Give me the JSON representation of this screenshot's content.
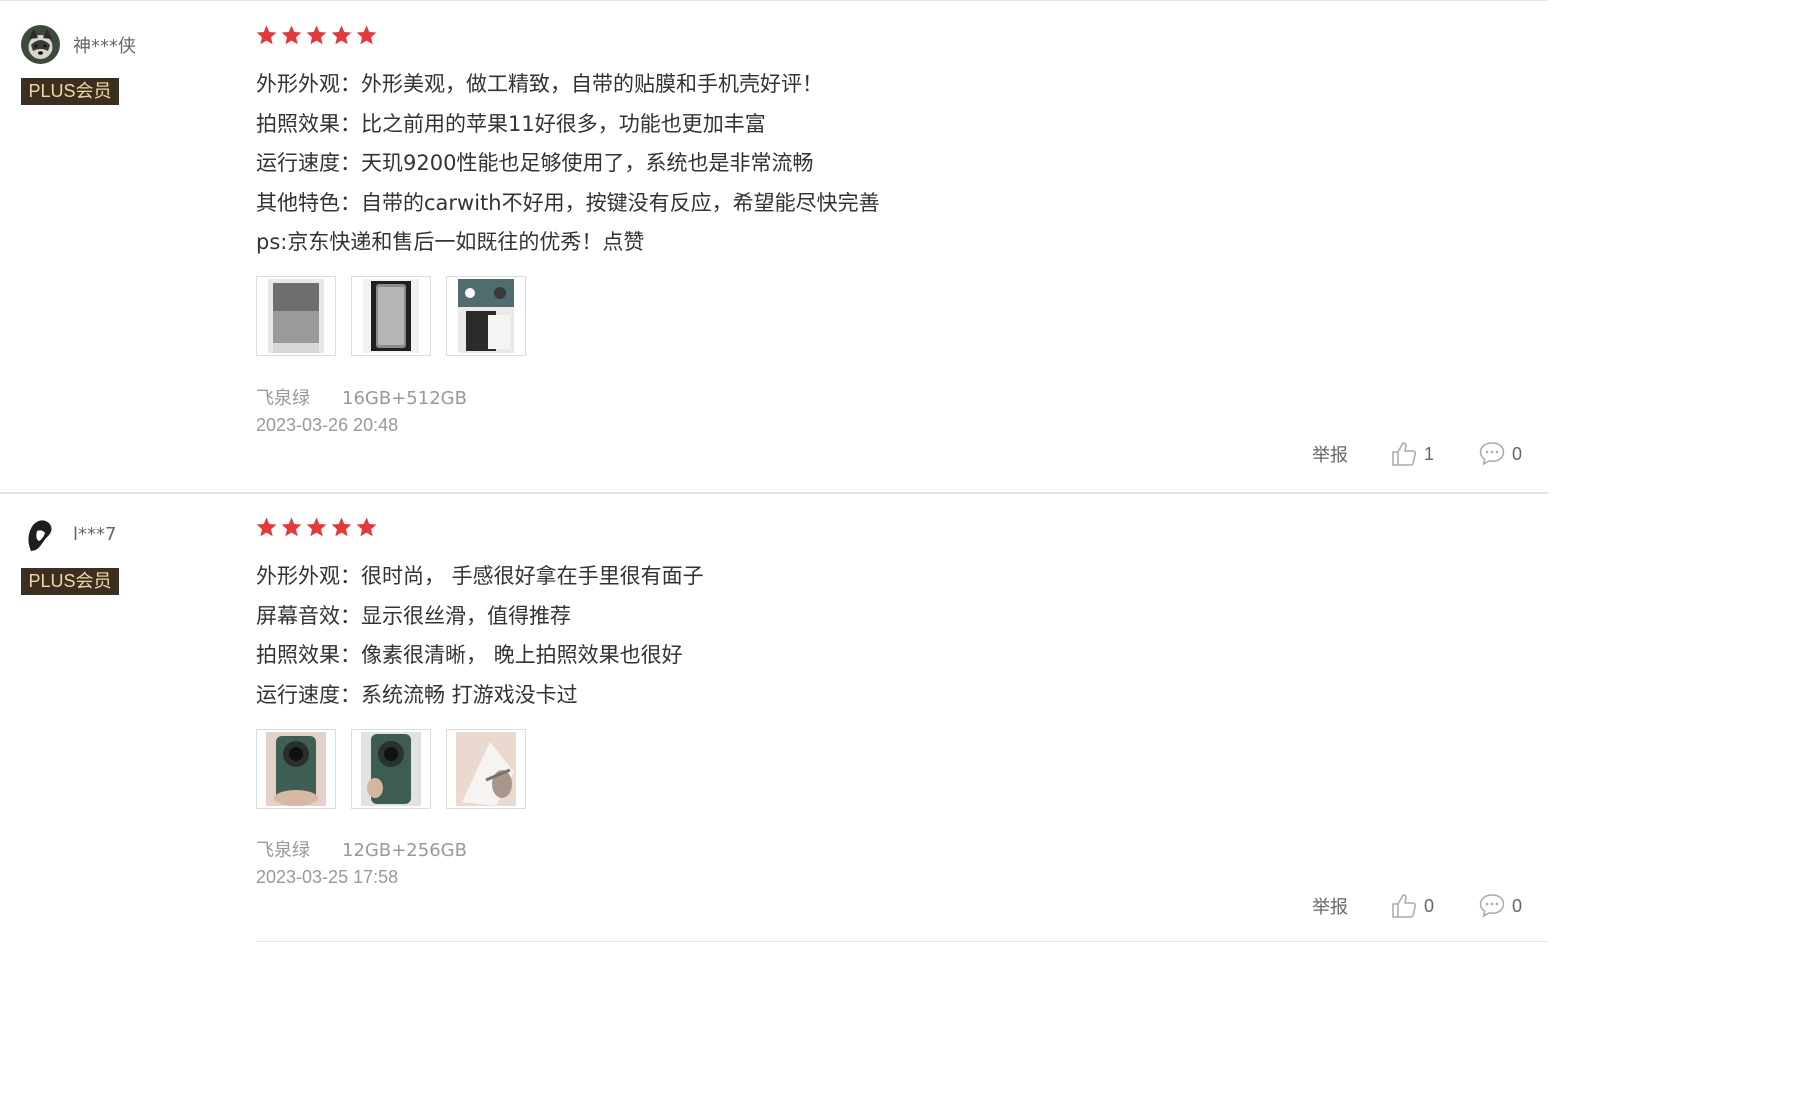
{
  "reviews": [
    {
      "username": "神***侠",
      "badge": "PLUS会员",
      "rating": 5,
      "lines": [
        "外形外观：外形美观，做工精致，自带的贴膜和手机壳好评！",
        "拍照效果：比之前用的苹果11好很多，功能也更加丰富",
        "运行速度：天玑9200性能也足够使用了，系统也是非常流畅",
        "其他特色：自带的carwith不好用，按键没有反应，希望能尽快完善",
        "ps:京东快递和售后一如既往的优秀！点赞"
      ],
      "color": "飞泉绿",
      "spec": "16GB+512GB",
      "date": "2023-03-26 20:48",
      "report_label": "举报",
      "likes": "1",
      "comments": "0"
    },
    {
      "username": "l***7",
      "badge": "PLUS会员",
      "rating": 5,
      "lines": [
        "外形外观：很时尚， 手感很好拿在手里很有面子",
        "屏幕音效：显示很丝滑，值得推荐",
        "拍照效果：像素很清晰， 晚上拍照效果也很好",
        "运行速度：系统流畅 打游戏没卡过"
      ],
      "color": "飞泉绿",
      "spec": "12GB+256GB",
      "date": "2023-03-25 17:58",
      "report_label": "举报",
      "likes": "0",
      "comments": "0"
    }
  ],
  "colors": {
    "star": "#e4393c",
    "badge_bg": "#3a2f20",
    "badge_text": "#f2d9a2",
    "meta_text": "#999999"
  }
}
